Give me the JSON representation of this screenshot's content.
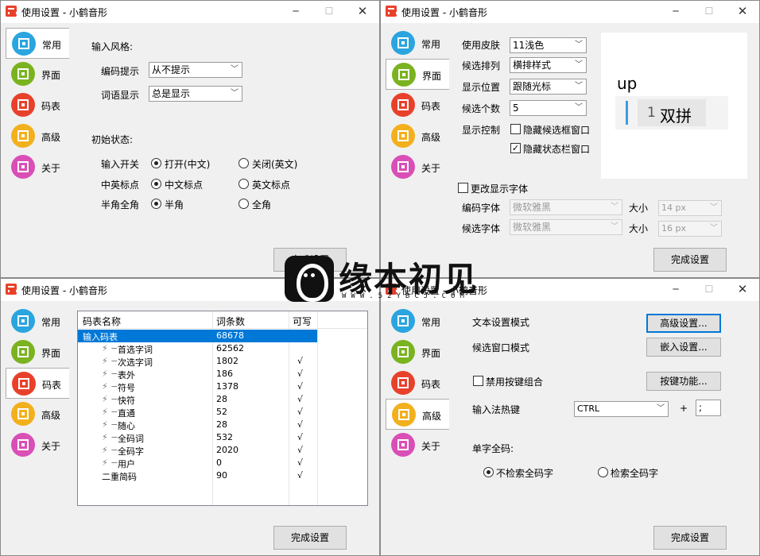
{
  "window_title": "使用设置 - 小鹤音形",
  "nav": [
    "常用",
    "界面",
    "码表",
    "高级",
    "关于"
  ],
  "nav_colors": [
    "#2aa5df",
    "#7ab31f",
    "#e8412b",
    "#f2b01d",
    "#d94fb6"
  ],
  "finish_button": "完成设置",
  "common": {
    "input_style_heading": "输入风格:",
    "code_hint_label": "编码提示",
    "code_hint_value": "从不提示",
    "word_display_label": "词语显示",
    "word_display_value": "总是显示",
    "initial_state_heading": "初始状态:",
    "input_switch_label": "输入开关",
    "input_switch_on": "打开(中文)",
    "input_switch_off": "关闭(英文)",
    "punct_label": "中英标点",
    "punct_cn": "中文标点",
    "punct_en": "英文标点",
    "width_label": "半角全角",
    "width_half": "半角",
    "width_full": "全角"
  },
  "ui": {
    "skin_label": "使用皮肤",
    "skin_value": "11浅色",
    "order_label": "候选排列",
    "order_value": "横排样式",
    "position_label": "显示位置",
    "position_value": "跟随光标",
    "count_label": "候选个数",
    "count_value": "5",
    "control_label": "显示控制",
    "hide_candidate_box": "隐藏候选框窗口",
    "hide_status_bar": "隐藏状态栏窗口",
    "change_font": "更改显示字体",
    "code_font_label": "编码字体",
    "code_font_value": "微软雅黑",
    "cand_font_label": "候选字体",
    "cand_font_value": "微软雅黑",
    "size_label": "大小",
    "code_size": "14 px",
    "cand_size": "16 px",
    "preview_code": "up",
    "preview_index": "1",
    "preview_candidate": "双拼"
  },
  "table": {
    "headers": [
      "码表名称",
      "词条数",
      "可写"
    ],
    "rows": [
      {
        "name": "输入码表",
        "count": "68678",
        "writable": ""
      },
      {
        "name": "首选字词",
        "count": "62562",
        "writable": ""
      },
      {
        "name": "次选字词",
        "count": "1802",
        "writable": "√"
      },
      {
        "name": "表外",
        "count": "186",
        "writable": "√"
      },
      {
        "name": "符号",
        "count": "1378",
        "writable": "√"
      },
      {
        "name": "快符",
        "count": "28",
        "writable": "√"
      },
      {
        "name": "直通",
        "count": "52",
        "writable": "√"
      },
      {
        "name": "随心",
        "count": "28",
        "writable": "√"
      },
      {
        "name": "全码词",
        "count": "532",
        "writable": "√"
      },
      {
        "name": "全码字",
        "count": "2020",
        "writable": "√"
      },
      {
        "name": "用户",
        "count": "0",
        "writable": "√"
      },
      {
        "name": "二重简码",
        "count": "90",
        "writable": "√"
      }
    ]
  },
  "advanced": {
    "text_mode_label": "文本设置模式",
    "text_mode_button": "高级设置...",
    "cand_mode_label": "候选窗口模式",
    "cand_mode_button": "嵌入设置...",
    "disable_combo": "禁用按键组合",
    "key_function_button": "按键功能...",
    "hotkey_label": "输入法热键",
    "hotkey_mod": "CTRL",
    "plus": "+",
    "hotkey_key": ";",
    "full_code_heading": "单字全码:",
    "no_search": "不检索全码字",
    "search": "检索全码字"
  },
  "watermark": {
    "text": "缘本初见",
    "sub": "WWW.52YBCJ.COM"
  }
}
